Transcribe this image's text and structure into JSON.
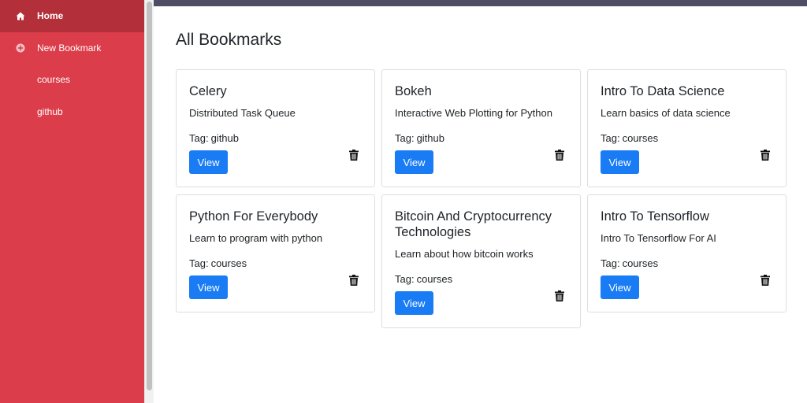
{
  "sidebar": {
    "items": [
      {
        "label": "Home",
        "icon": "home-icon",
        "active": true
      },
      {
        "label": "New Bookmark",
        "icon": "plus-circle-icon",
        "active": false
      },
      {
        "label": "courses",
        "icon": "",
        "active": false
      },
      {
        "label": "github",
        "icon": "",
        "active": false
      }
    ],
    "colors": {
      "background": "#dc3d4a",
      "active": "#b32f3a"
    }
  },
  "page": {
    "title": "All Bookmarks"
  },
  "bookmarks": [
    {
      "title": "Celery",
      "description": "Distributed Task Queue",
      "tag_prefix": "Tag:",
      "tag": "github",
      "view_label": "View"
    },
    {
      "title": "Bokeh",
      "description": "Interactive Web Plotting for Python",
      "tag_prefix": "Tag:",
      "tag": "github",
      "view_label": "View"
    },
    {
      "title": "Intro To Data Science",
      "description": "Learn basics of data science",
      "tag_prefix": "Tag:",
      "tag": "courses",
      "view_label": "View"
    },
    {
      "title": "Python For Everybody",
      "description": "Learn to program with python",
      "tag_prefix": "Tag:",
      "tag": "courses",
      "view_label": "View"
    },
    {
      "title": "Bitcoin And Cryptocurrency Technologies",
      "description": "Learn about how bitcoin works",
      "tag_prefix": "Tag:",
      "tag": "courses",
      "view_label": "View"
    },
    {
      "title": "Intro To Tensorflow",
      "description": "Intro To Tensorflow For AI",
      "tag_prefix": "Tag:",
      "tag": "courses",
      "view_label": "View"
    }
  ],
  "colors": {
    "primary_button": "#1a7cf5",
    "topbar": "#4d4e66"
  }
}
